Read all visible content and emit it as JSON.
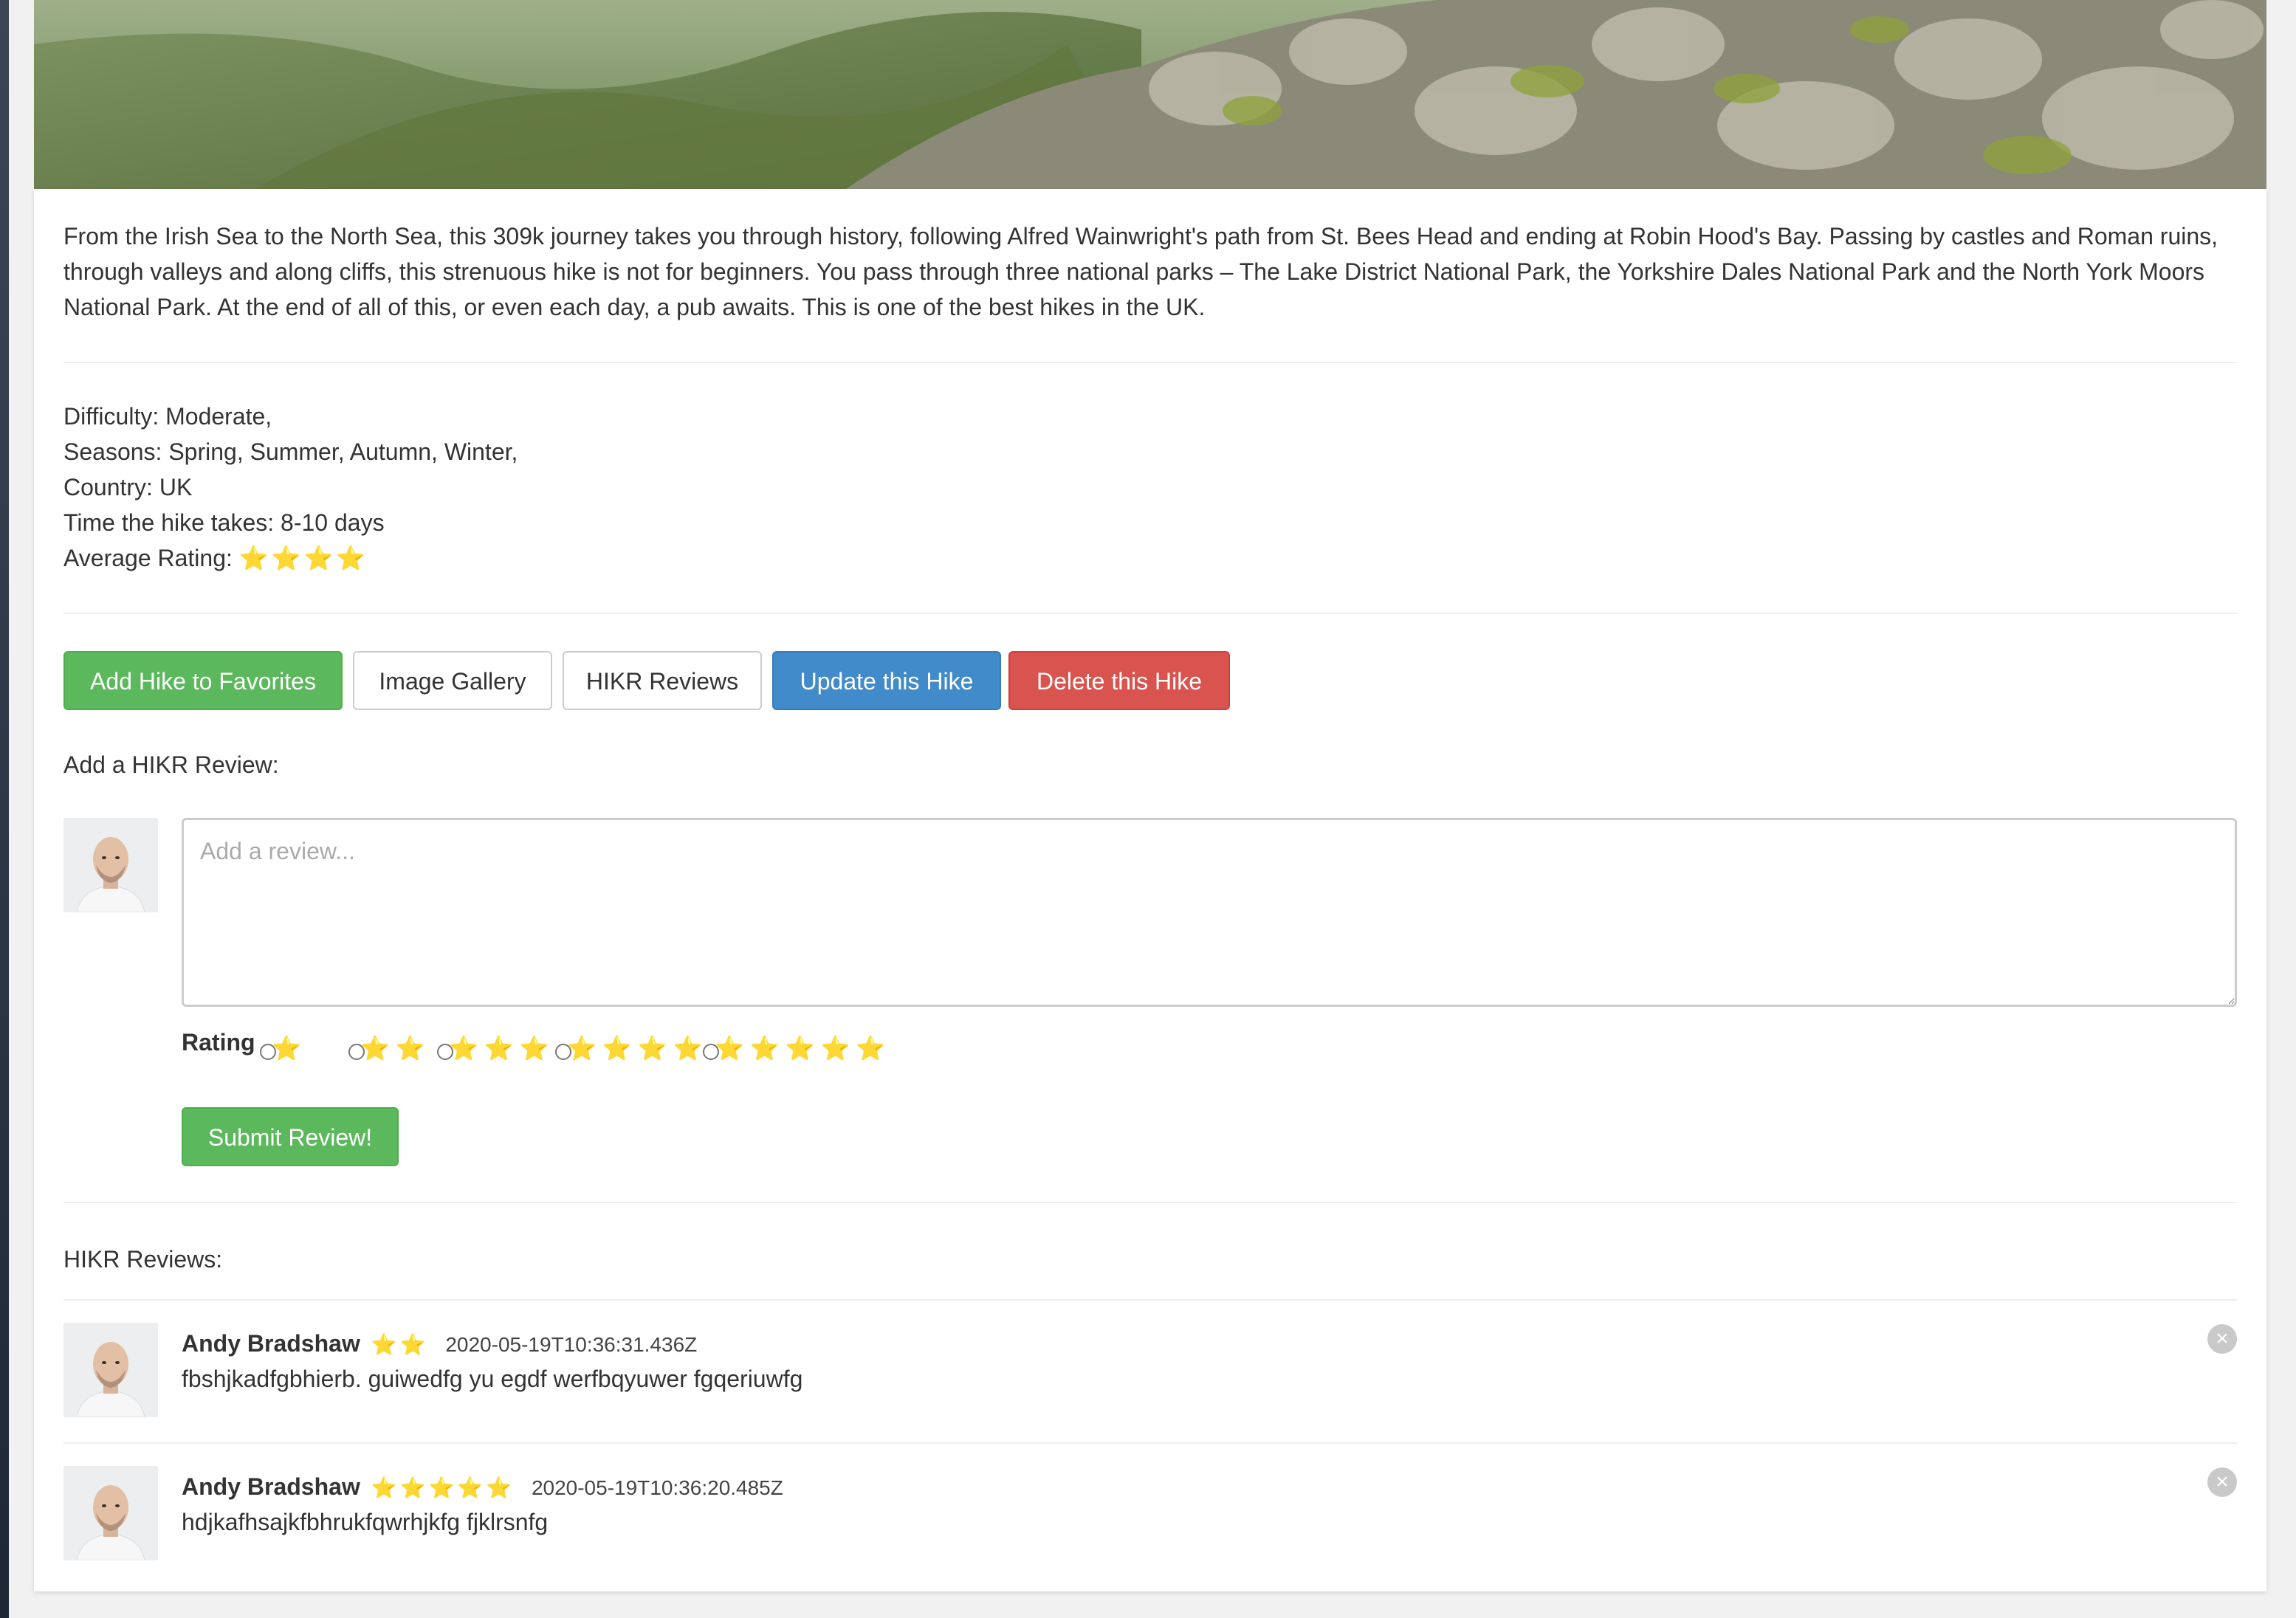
{
  "hike": {
    "description": "From the Irish Sea to the North Sea, this 309k journey takes you through history, following Alfred Wainwright's path from St. Bees Head and ending at Robin Hood's Bay. Passing by castles and Roman ruins, through valleys and along cliffs, this strenuous hike is not for beginners. You pass through three national parks – The Lake District National Park, the Yorkshire Dales National Park and the North York Moors National Park. At the end of all of this, or even each day, a pub awaits. This is one of the best hikes in the UK.",
    "difficulty": "Difficulty: Moderate,",
    "seasons": "Seasons: Spring, Summer, Autumn, Winter,",
    "country": "Country: UK",
    "duration": "Time the hike takes: 8-10 days",
    "average_rating_label": "Average Rating:",
    "average_rating_stars": "⭐⭐⭐⭐",
    "average_rating": 4
  },
  "actions": {
    "add_favorites": "Add Hike to Favorites",
    "image_gallery": "Image Gallery",
    "hikr_reviews": "HIKR Reviews",
    "update": "Update this Hike",
    "delete": "Delete this Hike"
  },
  "review_form": {
    "heading": "Add a HIKR Review:",
    "placeholder": "Add a review...",
    "rating_label": "Rating",
    "rating_options": [
      "⭐",
      "⭐⭐",
      "⭐⭐⭐",
      "⭐⭐⭐⭐",
      "⭐⭐⭐⭐⭐"
    ],
    "submit": "Submit Review!"
  },
  "reviews": {
    "heading": "HIKR Reviews:",
    "items": [
      {
        "author": "Andy Bradshaw",
        "stars": "⭐⭐",
        "rating": 2,
        "date": "2020-05-19T10:36:31.436Z",
        "text": "fbshjkadfgbhierb. guiwedfg yu egdf werfbqyuwer fgqeriuwfg"
      },
      {
        "author": "Andy Bradshaw",
        "stars": "⭐⭐⭐⭐⭐",
        "rating": 5,
        "date": "2020-05-19T10:36:20.485Z",
        "text": "hdjkafhsajkfbhrukfqwrhjkfg fjklrsnfg"
      }
    ]
  },
  "colors": {
    "success": "#5cb85c",
    "primary": "#428bca",
    "danger": "#d9534f",
    "star": "#f2b01e"
  }
}
